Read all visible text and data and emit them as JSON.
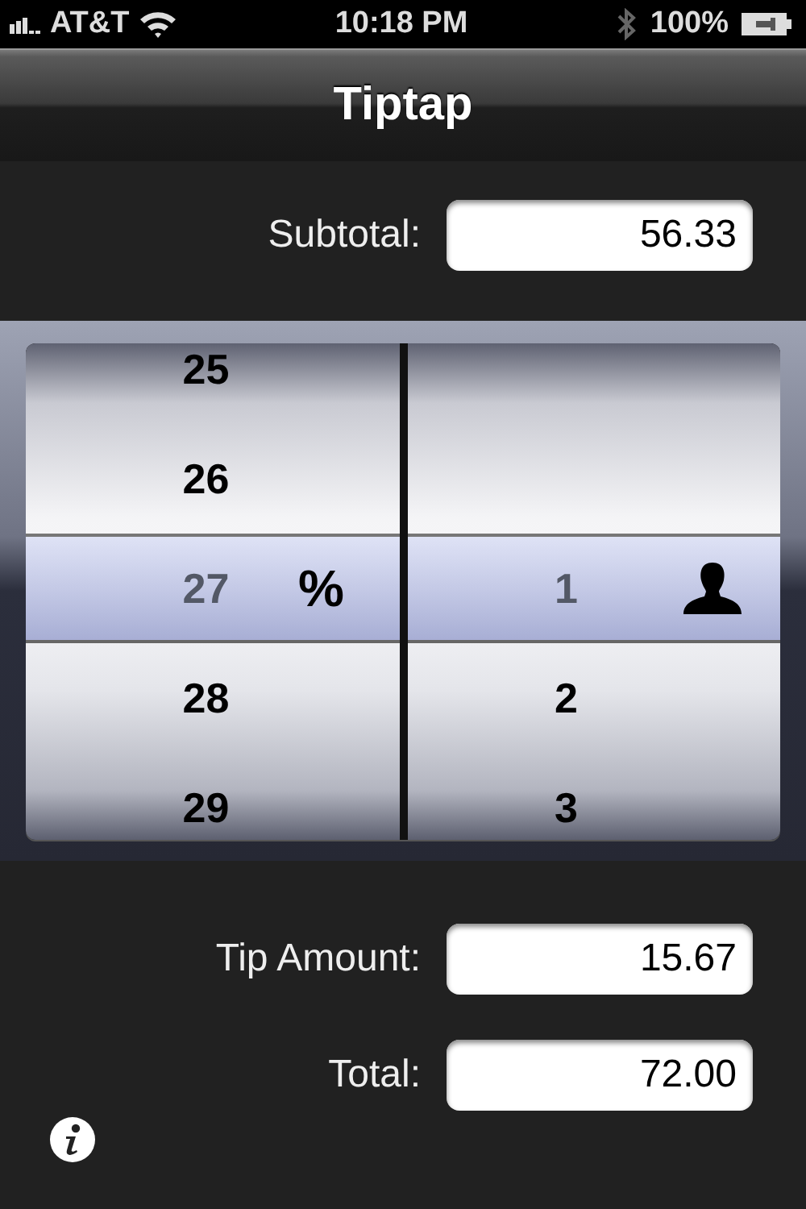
{
  "status_bar": {
    "carrier": "AT&T",
    "time": "10:18 PM",
    "battery": "100%"
  },
  "nav_bar": {
    "title": "Tiptap"
  },
  "subtotal": {
    "label": "Subtotal:",
    "value": "56.33"
  },
  "picker": {
    "columns": [
      {
        "kind": "percent",
        "unit": "%",
        "items": [
          {
            "label": "25",
            "selected": false
          },
          {
            "label": "26",
            "selected": false
          },
          {
            "label": "27",
            "selected": true
          },
          {
            "label": "28",
            "selected": false
          },
          {
            "label": "29",
            "selected": false
          }
        ]
      },
      {
        "kind": "people",
        "items": [
          {
            "label": "1",
            "selected": true
          },
          {
            "label": "2",
            "selected": false
          },
          {
            "label": "3",
            "selected": false
          }
        ]
      }
    ]
  },
  "results": [
    {
      "label": "Tip Amount:",
      "value": "15.67"
    },
    {
      "label": "Total:",
      "value": "72.00"
    }
  ]
}
